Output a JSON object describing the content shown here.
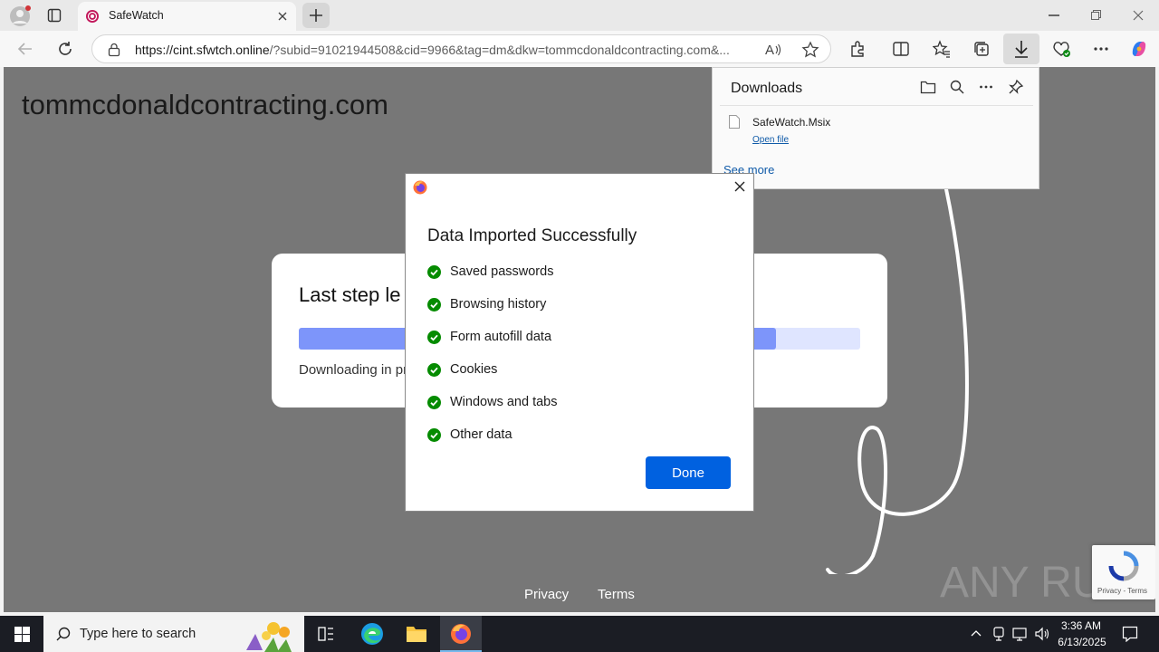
{
  "browser": {
    "tab_title": "SafeWatch",
    "url_host": "https://cint.sfwtch.online",
    "url_rest": "/?subid=91021944508&cid=9966&tag=dm&dkw=tommcdonaldcontracting.com&..."
  },
  "page": {
    "domain_heading": "tommcdonaldcontracting.com",
    "card_title": "Last step le",
    "card_status": "Downloading in pr",
    "progress_fraction": 0.85,
    "footer": {
      "privacy": "Privacy",
      "terms": "Terms"
    }
  },
  "downloads": {
    "title": "Downloads",
    "file_name": "SafeWatch.Msix",
    "open_file": "Open file",
    "see_more": "See more"
  },
  "dialog": {
    "title": "Data Imported Successfully",
    "items": [
      "Saved passwords",
      "Browsing history",
      "Form autofill data",
      "Cookies",
      "Windows and tabs",
      "Other data"
    ],
    "done_label": "Done"
  },
  "taskbar": {
    "search_placeholder": "Type here to search",
    "time": "3:36 AM",
    "date": "6/13/2025"
  },
  "watermark": "ANY RUN",
  "recaptcha": {
    "privacy": "Privacy",
    "terms": "Terms"
  },
  "colors": {
    "accent": "#0061e0",
    "check": "#058b00",
    "progress": "#7d95fa"
  }
}
